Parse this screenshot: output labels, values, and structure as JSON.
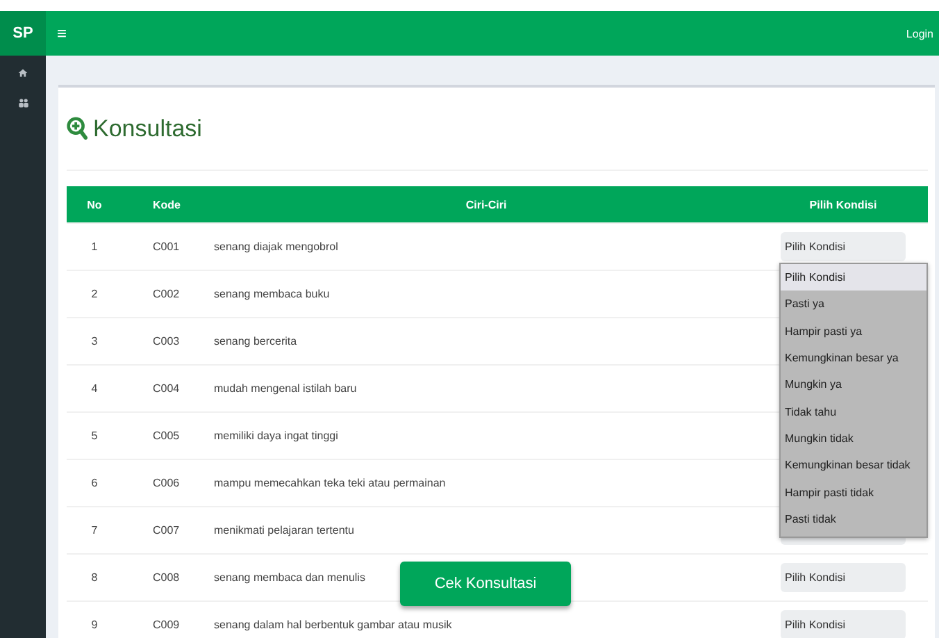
{
  "navbar": {
    "brand": "SP",
    "menu_icon": "≡",
    "login": "Login"
  },
  "page": {
    "title": "Konsultasi"
  },
  "table": {
    "columns": [
      "No",
      "Kode",
      "Ciri-Ciri",
      "Pilih Kondisi"
    ],
    "rows": [
      {
        "no": "1",
        "kode": "C001",
        "ciri": "senang diajak mengobrol",
        "select": "Pilih Kondisi"
      },
      {
        "no": "2",
        "kode": "C002",
        "ciri": "senang membaca buku"
      },
      {
        "no": "3",
        "kode": "C003",
        "ciri": "senang bercerita"
      },
      {
        "no": "4",
        "kode": "C004",
        "ciri": "mudah mengenal istilah baru"
      },
      {
        "no": "5",
        "kode": "C005",
        "ciri": "memiliki daya ingat tinggi"
      },
      {
        "no": "6",
        "kode": "C006",
        "ciri": "mampu memecahkan teka teki atau permainan"
      },
      {
        "no": "7",
        "kode": "C007",
        "ciri": "menikmati pelajaran tertentu",
        "select": ""
      },
      {
        "no": "8",
        "kode": "C008",
        "ciri": "senang membaca dan menulis",
        "select": "Pilih Kondisi"
      },
      {
        "no": "9",
        "kode": "C009",
        "ciri": "senang dalam hal berbentuk gambar atau musik",
        "select": "Pilih Kondisi"
      }
    ]
  },
  "dropdown": {
    "options": [
      {
        "label": "Pilih Kondisi",
        "selected": true
      },
      {
        "label": "Pasti ya",
        "selected": false
      },
      {
        "label": "Hampir pasti ya",
        "selected": false
      },
      {
        "label": "Kemungkinan besar ya",
        "selected": false
      },
      {
        "label": "Mungkin ya",
        "selected": false
      },
      {
        "label": "Tidak tahu",
        "selected": false
      },
      {
        "label": "Mungkin tidak",
        "selected": false
      },
      {
        "label": "Kemungkinan besar tidak",
        "selected": false
      },
      {
        "label": "Hampir pasti tidak",
        "selected": false
      },
      {
        "label": "Pasti tidak",
        "selected": false
      }
    ]
  },
  "submit_button": "Cek Konsultasi"
}
